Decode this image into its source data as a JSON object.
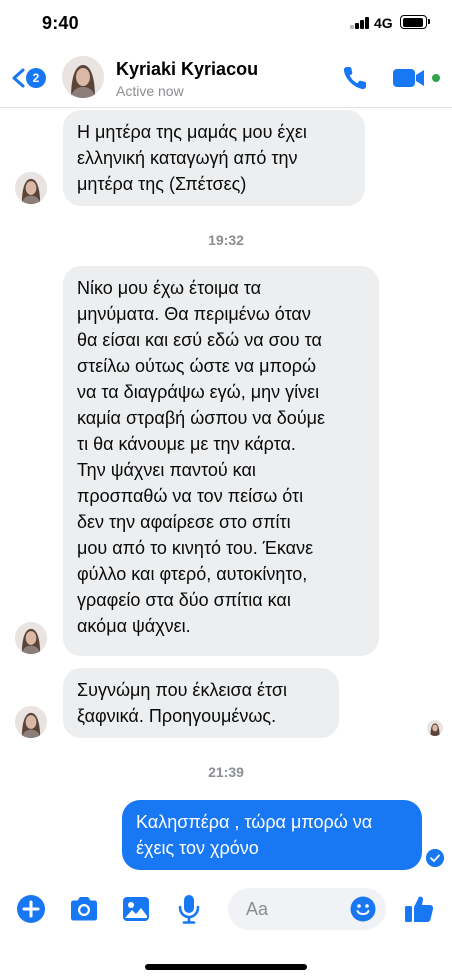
{
  "status_bar": {
    "time": "9:40",
    "network": "4G"
  },
  "header": {
    "back_count": "2",
    "contact_name": "Kyriaki Kyriacou",
    "contact_status": "Active now"
  },
  "messages": [
    {
      "direction": "incoming",
      "text": "Η μητέρα της μαμάς μου έχει\nελληνική καταγωγή από την\nμητέρα της (Σπέτσες)"
    },
    {
      "type": "timestamp",
      "text": "19:32"
    },
    {
      "direction": "incoming",
      "text": "Νίκο μου έχω έτοιμα τα\nμηνύματα. Θα περιμένω όταν\nθα είσαι και εσύ εδώ να σου τα\nστείλω ούτως ώστε να μπορώ\nνα τα διαγράψω εγώ, μην γίνει\nκαμία στραβή ώσπου να δούμε\nτι θα κάνουμε με την κάρτα.\nΤην ψάχνει παντού και\nπροσπαθώ να τον πείσω ότι\nδεν την αφαίρεσε στο σπίτι\nμου από το κινητό του. Έκανε\nφύλλο και φτερό, αυτοκίνητο,\nγραφείο στα δύο σπίτια και\nακόμα ψάχνει."
    },
    {
      "direction": "incoming",
      "text": "Συγνώμη που έκλεισα έτσι\nξαφνικά. Προηγουμένως."
    },
    {
      "type": "timestamp",
      "text": "21:39"
    },
    {
      "direction": "outgoing",
      "text": "Καλησπέρα , τώρα μπορώ να\nέχεις τον χρόνο"
    }
  ],
  "composer": {
    "placeholder": "Aa"
  },
  "colors": {
    "accent": "#1877f2",
    "incoming_bubble": "#eceef0",
    "online": "#31a24c",
    "muted_text": "#8a8d91"
  },
  "icons": [
    "chevron-left-icon",
    "phone-icon",
    "video-camera-icon",
    "plus-circle-icon",
    "camera-icon",
    "image-icon",
    "microphone-icon",
    "smiley-icon",
    "thumbs-up-icon",
    "check-circle-icon"
  ]
}
